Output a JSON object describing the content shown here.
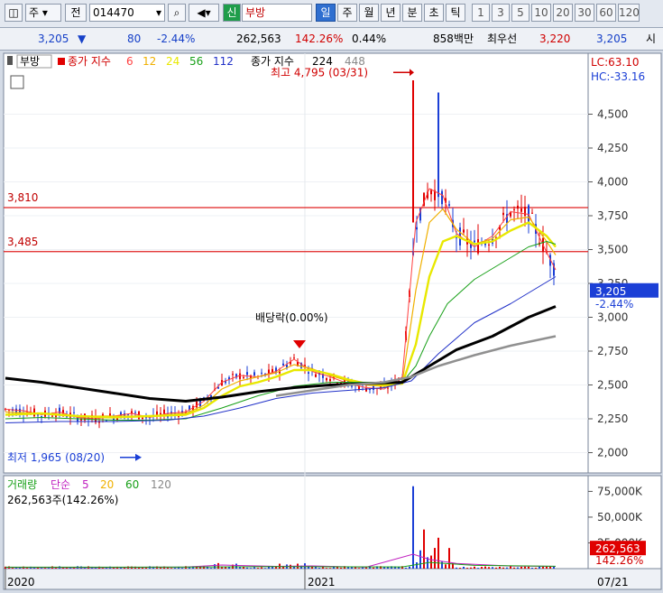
{
  "toolbar": {
    "market_label": "주",
    "type_label": "전",
    "code": "014470",
    "credit_label": "신",
    "name": "부방",
    "periods": [
      "일",
      "주",
      "월",
      "년",
      "분",
      "초",
      "틱"
    ],
    "active_period": "일",
    "intervals": [
      "1",
      "3",
      "5",
      "10",
      "20",
      "30",
      "60",
      "120"
    ]
  },
  "quote": {
    "price": "3,205",
    "change": "80",
    "change_pct": "-2.44%",
    "volume": "262,563",
    "volume_ratio": "142.26%",
    "turnover": "0.44%",
    "trade_value": "858백만",
    "best_bid_label": "최우선",
    "best_bid": "3,220",
    "best_ask": "3,205",
    "tail": "시"
  },
  "colors": {
    "up": "#e00000",
    "down": "#1b3fd6",
    "ma6": "#ff4040",
    "ma12": "#f0b000",
    "ma24": "#e8e800",
    "ma56": "#18a018",
    "ma112": "#2030c8",
    "ma224": "#000000",
    "ma448": "#909090",
    "hline": "#e02020"
  },
  "chart_data": {
    "type": "candlestick",
    "legend": {
      "name": "부방",
      "label1": "종가 지수",
      "ma1": [
        "6",
        "12",
        "24",
        "56",
        "112"
      ],
      "label2": "종가 지수",
      "ma2": [
        "224",
        "448"
      ]
    },
    "price_ticks": [
      "4,500",
      "4,250",
      "4,000",
      "3,750",
      "3,500",
      "3,250",
      "3,000",
      "2,750",
      "2,500",
      "2,250",
      "2,000"
    ],
    "ylim": [
      1850,
      4950
    ],
    "lc": "LC:63.10",
    "hc": "HC:-33.16",
    "high_label": "최고 4,795 (03/31)",
    "low_label": "최저 1,965 (08/20)",
    "hlines": [
      {
        "label": "3,810",
        "value": 3810
      },
      {
        "label": "3,485",
        "value": 3485
      }
    ],
    "dividend_label": "배당락(0.00%)",
    "current_price": "3,205",
    "current_pct": "-2.44%",
    "x_labels": [
      "2020",
      "2021",
      "07/21"
    ],
    "ma_series": {
      "ma6": [
        [
          0,
          2320
        ],
        [
          20,
          2310
        ],
        [
          40,
          2280
        ],
        [
          60,
          2300
        ],
        [
          80,
          2260
        ],
        [
          100,
          2250
        ],
        [
          120,
          2270
        ],
        [
          140,
          2290
        ],
        [
          160,
          2260
        ],
        [
          180,
          2290
        ],
        [
          200,
          2300
        ],
        [
          220,
          2380
        ],
        [
          240,
          2520
        ],
        [
          260,
          2570
        ],
        [
          280,
          2560
        ],
        [
          300,
          2600
        ],
        [
          320,
          2690
        ],
        [
          340,
          2600
        ],
        [
          360,
          2560
        ],
        [
          380,
          2510
        ],
        [
          400,
          2480
        ],
        [
          420,
          2470
        ],
        [
          440,
          2560
        ],
        [
          455,
          3700
        ],
        [
          470,
          3950
        ],
        [
          485,
          3900
        ],
        [
          500,
          3620
        ],
        [
          520,
          3520
        ],
        [
          540,
          3600
        ],
        [
          560,
          3780
        ],
        [
          580,
          3760
        ],
        [
          600,
          3480
        ],
        [
          610,
          3350
        ]
      ],
      "ma12": [
        [
          0,
          2300
        ],
        [
          40,
          2290
        ],
        [
          80,
          2270
        ],
        [
          120,
          2270
        ],
        [
          160,
          2270
        ],
        [
          200,
          2290
        ],
        [
          220,
          2350
        ],
        [
          240,
          2470
        ],
        [
          260,
          2530
        ],
        [
          280,
          2560
        ],
        [
          300,
          2590
        ],
        [
          320,
          2650
        ],
        [
          340,
          2620
        ],
        [
          360,
          2570
        ],
        [
          380,
          2530
        ],
        [
          400,
          2500
        ],
        [
          420,
          2490
        ],
        [
          440,
          2520
        ],
        [
          455,
          3200
        ],
        [
          470,
          3700
        ],
        [
          485,
          3800
        ],
        [
          500,
          3650
        ],
        [
          520,
          3540
        ],
        [
          540,
          3580
        ],
        [
          560,
          3720
        ],
        [
          580,
          3740
        ],
        [
          600,
          3560
        ],
        [
          610,
          3460
        ]
      ],
      "ma24": [
        [
          0,
          2280
        ],
        [
          40,
          2290
        ],
        [
          80,
          2270
        ],
        [
          120,
          2260
        ],
        [
          160,
          2270
        ],
        [
          200,
          2280
        ],
        [
          220,
          2330
        ],
        [
          240,
          2420
        ],
        [
          260,
          2490
        ],
        [
          280,
          2520
        ],
        [
          300,
          2560
        ],
        [
          320,
          2610
        ],
        [
          340,
          2610
        ],
        [
          360,
          2580
        ],
        [
          380,
          2540
        ],
        [
          400,
          2510
        ],
        [
          420,
          2500
        ],
        [
          440,
          2510
        ],
        [
          455,
          2800
        ],
        [
          470,
          3300
        ],
        [
          485,
          3560
        ],
        [
          500,
          3600
        ],
        [
          520,
          3540
        ],
        [
          540,
          3560
        ],
        [
          560,
          3640
        ],
        [
          580,
          3700
        ],
        [
          600,
          3600
        ],
        [
          610,
          3520
        ]
      ],
      "ma56": [
        [
          0,
          2250
        ],
        [
          40,
          2260
        ],
        [
          80,
          2250
        ],
        [
          120,
          2240
        ],
        [
          160,
          2240
        ],
        [
          200,
          2250
        ],
        [
          240,
          2330
        ],
        [
          280,
          2420
        ],
        [
          320,
          2490
        ],
        [
          360,
          2520
        ],
        [
          400,
          2520
        ],
        [
          440,
          2520
        ],
        [
          455,
          2640
        ],
        [
          470,
          2860
        ],
        [
          490,
          3100
        ],
        [
          520,
          3280
        ],
        [
          550,
          3400
        ],
        [
          580,
          3520
        ],
        [
          600,
          3560
        ],
        [
          610,
          3540
        ]
      ],
      "ma112": [
        [
          0,
          2220
        ],
        [
          60,
          2230
        ],
        [
          120,
          2230
        ],
        [
          180,
          2240
        ],
        [
          220,
          2270
        ],
        [
          260,
          2330
        ],
        [
          300,
          2400
        ],
        [
          340,
          2440
        ],
        [
          380,
          2460
        ],
        [
          420,
          2480
        ],
        [
          450,
          2530
        ],
        [
          480,
          2730
        ],
        [
          520,
          2960
        ],
        [
          560,
          3100
        ],
        [
          590,
          3220
        ],
        [
          610,
          3300
        ]
      ],
      "ma224": [
        [
          0,
          2550
        ],
        [
          40,
          2520
        ],
        [
          80,
          2480
        ],
        [
          120,
          2440
        ],
        [
          160,
          2400
        ],
        [
          200,
          2380
        ],
        [
          240,
          2410
        ],
        [
          280,
          2450
        ],
        [
          320,
          2480
        ],
        [
          360,
          2500
        ],
        [
          400,
          2510
        ],
        [
          440,
          2520
        ],
        [
          470,
          2640
        ],
        [
          500,
          2760
        ],
        [
          540,
          2860
        ],
        [
          580,
          3000
        ],
        [
          610,
          3080
        ]
      ],
      "ma448": [
        [
          300,
          2420
        ],
        [
          340,
          2460
        ],
        [
          380,
          2500
        ],
        [
          420,
          2520
        ],
        [
          450,
          2560
        ],
        [
          480,
          2640
        ],
        [
          520,
          2720
        ],
        [
          560,
          2790
        ],
        [
          610,
          2860
        ]
      ]
    },
    "volume_panel": {
      "legend": {
        "label1": "거래량",
        "label2": "단순",
        "mas": [
          "5",
          "20",
          "60",
          "120"
        ]
      },
      "summary": "262,563주(142.26%)",
      "ticks": [
        "75,000K",
        "50,000K",
        "25,000K"
      ],
      "current": "262,563",
      "current_pct": "142.26%",
      "ylim": [
        0,
        85000
      ]
    }
  }
}
